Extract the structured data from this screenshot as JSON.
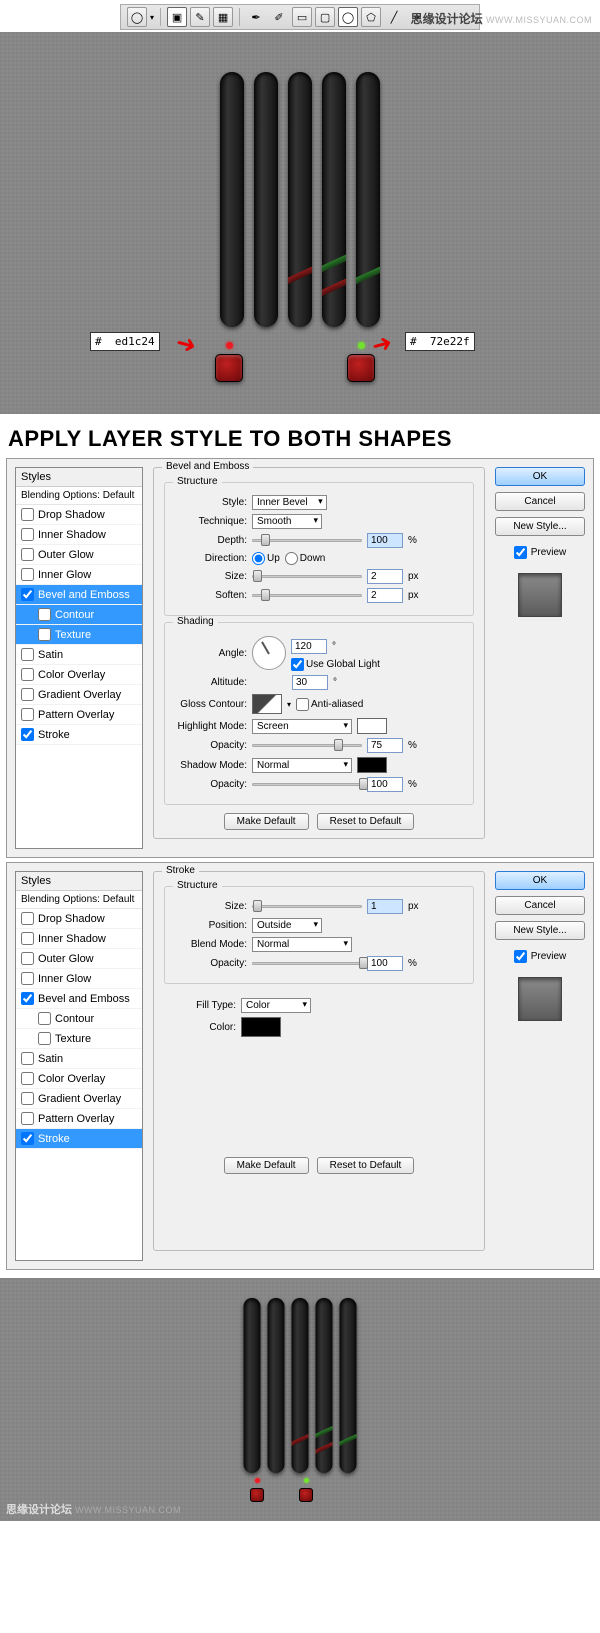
{
  "toolbar": {
    "icons": [
      "ellipse",
      "divider",
      "new-layer",
      "path",
      "pixel",
      "pen",
      "freeform-pen",
      "rect",
      "rounded-rect",
      "ellipse2",
      "polygon",
      "line",
      "custom-shape"
    ]
  },
  "watermark": {
    "cn": "思缘设计论坛",
    "url": "WWW.MISSYUAN.COM"
  },
  "hex": {
    "red": "ed1c24",
    "green": "72e22f",
    "hash": "#"
  },
  "title": "APPLY LAYER STYLE TO BOTH SHAPES",
  "stylesPanel": {
    "head": "Styles",
    "blending": "Blending Options: Default",
    "items": [
      {
        "label": "Drop Shadow",
        "checked": false,
        "indent": false
      },
      {
        "label": "Inner Shadow",
        "checked": false,
        "indent": false
      },
      {
        "label": "Outer Glow",
        "checked": false,
        "indent": false
      },
      {
        "label": "Inner Glow",
        "checked": false,
        "indent": false
      },
      {
        "label": "Bevel and Emboss",
        "checked": true,
        "indent": false,
        "sel": true
      },
      {
        "label": "Contour",
        "checked": false,
        "indent": true,
        "sel": true
      },
      {
        "label": "Texture",
        "checked": false,
        "indent": true,
        "sel": true
      },
      {
        "label": "Satin",
        "checked": false,
        "indent": false
      },
      {
        "label": "Color Overlay",
        "checked": false,
        "indent": false
      },
      {
        "label": "Gradient Overlay",
        "checked": false,
        "indent": false
      },
      {
        "label": "Pattern Overlay",
        "checked": false,
        "indent": false
      },
      {
        "label": "Stroke",
        "checked": true,
        "indent": false
      }
    ]
  },
  "bevel": {
    "title": "Bevel and Emboss",
    "structure": "Structure",
    "styleLbl": "Style:",
    "styleVal": "Inner Bevel",
    "techLbl": "Technique:",
    "techVal": "Smooth",
    "depthLbl": "Depth:",
    "depthVal": "100",
    "pct": "%",
    "dirLbl": "Direction:",
    "up": "Up",
    "down": "Down",
    "sizeLbl": "Size:",
    "sizeVal": "2",
    "px": "px",
    "softenLbl": "Soften:",
    "softenVal": "2",
    "shading": "Shading",
    "angleLbl": "Angle:",
    "angleVal": "120",
    "deg": "°",
    "globalLight": "Use Global Light",
    "altLbl": "Altitude:",
    "altVal": "30",
    "glossLbl": "Gloss Contour:",
    "aa": "Anti-aliased",
    "hlLbl": "Highlight Mode:",
    "hlVal": "Screen",
    "opLbl": "Opacity:",
    "hlOp": "75",
    "shLbl": "Shadow Mode:",
    "shVal": "Normal",
    "shOp": "100",
    "makeDef": "Make Default",
    "resetDef": "Reset to Default"
  },
  "stroke": {
    "title": "Stroke",
    "structure": "Structure",
    "sizeLbl": "Size:",
    "sizeVal": "1",
    "px": "px",
    "posLbl": "Position:",
    "posVal": "Outside",
    "blendLbl": "Blend Mode:",
    "blendVal": "Normal",
    "opLbl": "Opacity:",
    "opVal": "100",
    "pct": "%",
    "fillLbl": "Fill Type:",
    "fillVal": "Color",
    "colorLbl": "Color:",
    "makeDef": "Make Default",
    "resetDef": "Reset to Default"
  },
  "stylesPanel2": {
    "head": "Styles",
    "blending": "Blending Options: Default",
    "items": [
      {
        "label": "Drop Shadow",
        "checked": false
      },
      {
        "label": "Inner Shadow",
        "checked": false
      },
      {
        "label": "Outer Glow",
        "checked": false
      },
      {
        "label": "Inner Glow",
        "checked": false
      },
      {
        "label": "Bevel and Emboss",
        "checked": true
      },
      {
        "label": "Contour",
        "checked": false,
        "indent": true
      },
      {
        "label": "Texture",
        "checked": false,
        "indent": true
      },
      {
        "label": "Satin",
        "checked": false
      },
      {
        "label": "Color Overlay",
        "checked": false
      },
      {
        "label": "Gradient Overlay",
        "checked": false
      },
      {
        "label": "Pattern Overlay",
        "checked": false
      },
      {
        "label": "Stroke",
        "checked": true,
        "sel": true
      }
    ]
  },
  "rightCol": {
    "ok": "OK",
    "cancel": "Cancel",
    "newStyle": "New Style...",
    "preview": "Preview"
  }
}
